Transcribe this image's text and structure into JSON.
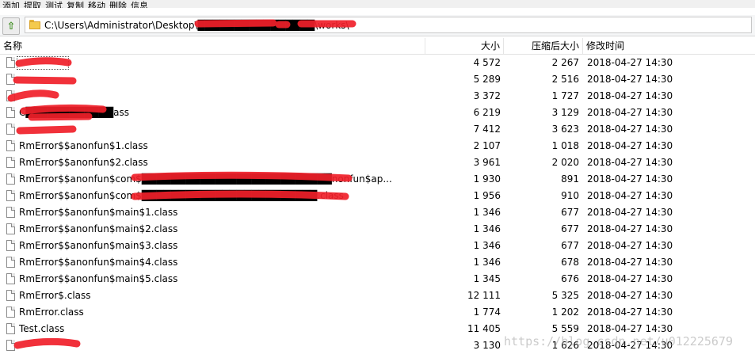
{
  "menu": [
    "添加",
    "提取",
    "测试",
    "复制",
    "移动",
    "删除",
    "信息"
  ],
  "path": "C:\\Users\\Administrator\\Desktop\\████████████████\\works\\",
  "columns": {
    "name": "名称",
    "size": "大小",
    "packed": "压缩后大小",
    "modified": "修改时间"
  },
  "files": [
    {
      "name": "",
      "size": "4 572",
      "packed": "2 267",
      "modified": "2018-04-27 14:30"
    },
    {
      "name": "",
      "size": "5 289",
      "packed": "2 516",
      "modified": "2018-04-27 14:30"
    },
    {
      "name": "",
      "size": "3 372",
      "packed": "1 727",
      "modified": "2018-04-27 14:30"
    },
    {
      "name": "C████████████ass",
      "size": "6 219",
      "packed": "3 129",
      "modified": "2018-04-27 14:30"
    },
    {
      "name": "",
      "size": "7 412",
      "packed": "3 623",
      "modified": "2018-04-27 14:30"
    },
    {
      "name": "RmError$$anonfun$1.class",
      "size": "2 107",
      "packed": "1 018",
      "modified": "2018-04-27 14:30"
    },
    {
      "name": "RmError$$anonfun$2.class",
      "size": "3 961",
      "packed": "2 020",
      "modified": "2018-04-27 14:30"
    },
    {
      "name": "RmError$$anonfun$com$██████████████████████████nonfun$ap...",
      "size": "1 930",
      "packed": "891",
      "modified": "2018-04-27 14:30"
    },
    {
      "name": "RmError$$anonfun$com$████████████████████████.class",
      "size": "1 956",
      "packed": "910",
      "modified": "2018-04-27 14:30"
    },
    {
      "name": "RmError$$anonfun$main$1.class",
      "size": "1 346",
      "packed": "677",
      "modified": "2018-04-27 14:30"
    },
    {
      "name": "RmError$$anonfun$main$2.class",
      "size": "1 346",
      "packed": "677",
      "modified": "2018-04-27 14:30"
    },
    {
      "name": "RmError$$anonfun$main$3.class",
      "size": "1 346",
      "packed": "677",
      "modified": "2018-04-27 14:30"
    },
    {
      "name": "RmError$$anonfun$main$4.class",
      "size": "1 346",
      "packed": "678",
      "modified": "2018-04-27 14:30"
    },
    {
      "name": "RmError$$anonfun$main$5.class",
      "size": "1 345",
      "packed": "676",
      "modified": "2018-04-27 14:30"
    },
    {
      "name": "RmError$.class",
      "size": "12 111",
      "packed": "5 325",
      "modified": "2018-04-27 14:30"
    },
    {
      "name": "RmError.class",
      "size": "1 774",
      "packed": "1 202",
      "modified": "2018-04-27 14:30"
    },
    {
      "name": "Test.class",
      "size": "11 405",
      "packed": "5 559",
      "modified": "2018-04-27 14:30"
    },
    {
      "name": "",
      "size": "3 130",
      "packed": "1 626",
      "modified": "2018-04-27 14:30"
    }
  ],
  "watermark": "https://blog.csdn.net/u012225679",
  "colors": {
    "redaction": "#f0202a",
    "folder": "#f4ca4e"
  }
}
